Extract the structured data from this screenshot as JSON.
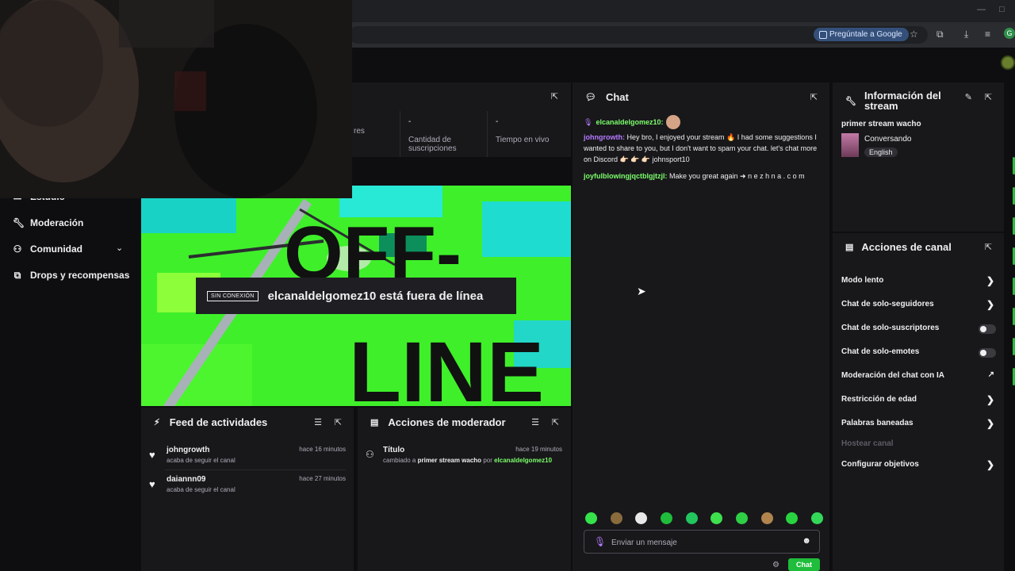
{
  "browser": {
    "ask_google": "Pregúntale a Google",
    "profile_initial": "G"
  },
  "sidebar": {
    "items": [
      {
        "label": "Estudio",
        "icon": "studio-icon"
      },
      {
        "label": "Moderación",
        "icon": "wrench-icon"
      },
      {
        "label": "Comunidad",
        "icon": "community-icon"
      },
      {
        "label": "Drops y recompensas",
        "icon": "drops-icon"
      }
    ]
  },
  "stats": {
    "cols": [
      {
        "value": "",
        "label": "res"
      },
      {
        "value": "-",
        "label": "Cantidad de suscripciones"
      },
      {
        "value": "-",
        "label": "Tiempo en vivo"
      }
    ]
  },
  "preview": {
    "offline_tag": "SIN CONEXIÓN",
    "offline_text": "elcanaldelgomez10 está fuera de línea"
  },
  "feed": {
    "title": "Feed de actividades",
    "items": [
      {
        "user": "johngrowth",
        "action": "acaba de seguir el canal",
        "time": "hace 16 minutos"
      },
      {
        "user": "daiannn09",
        "action": "acaba de seguir el canal",
        "time": "hace 27 minutos"
      }
    ]
  },
  "mod_actions": {
    "title": "Acciones de moderador",
    "items": [
      {
        "label": "Título",
        "time": "hace 19 minutos",
        "prefix": "cambiado a",
        "value": "primer stream wacho",
        "by": "por",
        "moderator": "elcanaldelgomez10"
      }
    ]
  },
  "chat": {
    "title": "Chat",
    "messages": [
      {
        "user": "elcanaldelgomez10:",
        "text": ""
      },
      {
        "user": "johngrowth:",
        "text": "Hey bro, I enjoyed your stream 🔥 I had some suggestions I wanted to share to you, but I don't want to spam your chat. let's chat more on Discord 👉🏻 👉🏻 👉🏻 johnsport10"
      },
      {
        "user": "joyfulblowingjqctblgjtzjl:",
        "text": "Make you great again ➜ n e z h n a . c o m"
      }
    ],
    "input_placeholder": "Enviar un mensaje",
    "send_label": "Chat"
  },
  "stream_info": {
    "title": "Información del stream",
    "stream_title": "primer stream wacho",
    "category": "Conversando",
    "language": "English"
  },
  "channel_actions": {
    "title": "Acciones de canal",
    "items": [
      {
        "label": "Modo lento",
        "control": "arrow"
      },
      {
        "label": "Chat de solo-seguidores",
        "control": "arrow"
      },
      {
        "label": "Chat de solo-suscriptores",
        "control": "toggle",
        "enabled": false
      },
      {
        "label": "Chat de solo-emotes",
        "control": "toggle",
        "enabled": false
      },
      {
        "label": "Moderación del chat con IA",
        "control": "external"
      },
      {
        "label": "Restricción de edad",
        "control": "arrow"
      },
      {
        "label": "Palabras baneadas",
        "control": "arrow"
      },
      {
        "label": "Hostear canal",
        "control": "none",
        "disabled": true
      },
      {
        "label": "Configurar objetivos",
        "control": "arrow"
      }
    ]
  },
  "colors": {
    "accent_green": "#1fbd3b",
    "username_purple": "#b77bff",
    "username_green": "#7cff6b",
    "panel_bg": "#18181b",
    "page_bg": "#0e0e10"
  }
}
